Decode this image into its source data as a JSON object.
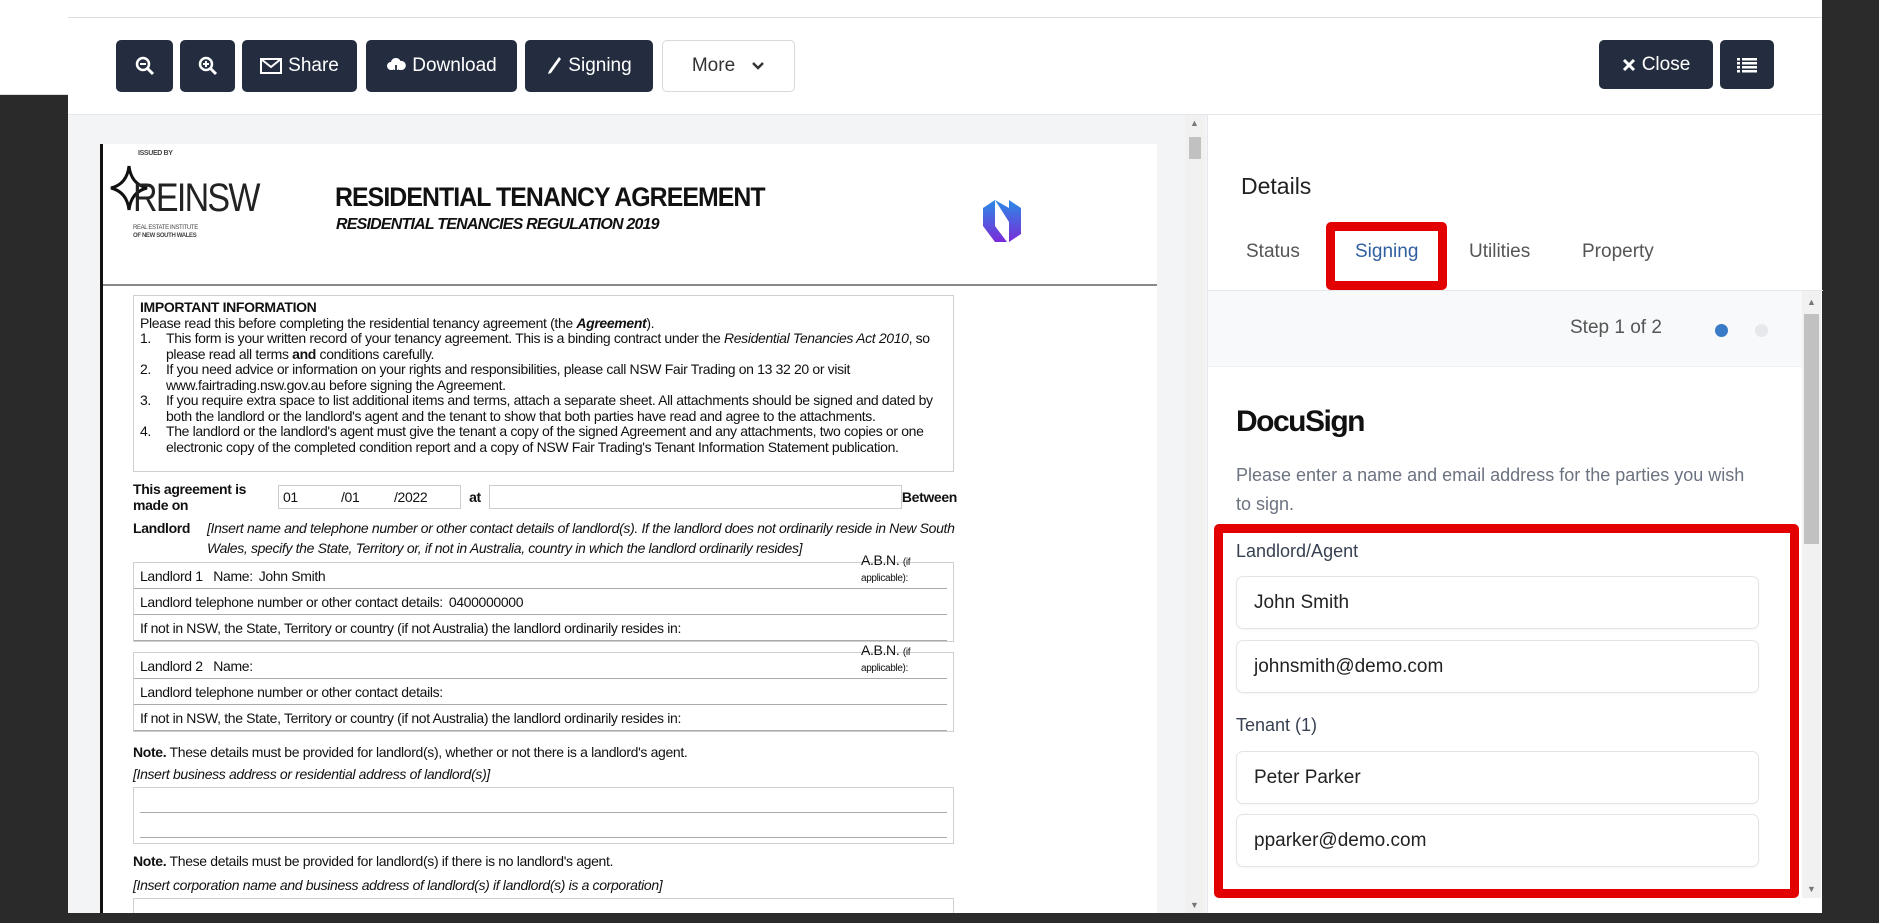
{
  "toolbar": {
    "zoom_out": "zoom-out",
    "zoom_in": "zoom-in",
    "share": "Share",
    "download": "Download",
    "signing": "Signing",
    "more": "More",
    "close": "Close"
  },
  "document": {
    "issued_by": "ISSUED BY",
    "logo_text": "REINSW",
    "logo_sub1": "REAL ESTATE INSTITUTE",
    "logo_sub2": "OF NEW SOUTH WALES",
    "title": "RESIDENTIAL TENANCY AGREEMENT",
    "subtitle": "RESIDENTIAL TENANCIES REGULATION 2019",
    "important": {
      "heading": "IMPORTANT INFORMATION",
      "intro_a": "Please read this before completing the residential tenancy agreement (the ",
      "intro_b": "Agreement",
      "intro_c": ").",
      "items": [
        {
          "n": "1.",
          "a": "This form is your written record of your tenancy agreement. This is a binding contract under the ",
          "i": "Residential Tenancies Act 2010",
          "b": ", so please read all terms ",
          "bold": "and",
          "c": " conditions carefully."
        },
        {
          "n": "2.",
          "a": "If you need advice or information on your rights and responsibilities, please call NSW Fair Trading on 13 32 20 or visit www.fairtrading.nsw.gov.au before signing the Agreement."
        },
        {
          "n": "3.",
          "a": "If you require extra space to list additional items and terms, attach a separate sheet. All attachments should be signed and dated by both the landlord or the landlord's agent and the tenant to show that both parties have read and agree to the attachments."
        },
        {
          "n": "4.",
          "a": "The landlord or the landlord's agent must give the tenant a copy of the signed Agreement and any attachments, two copies or one electronic copy of the completed condition report and a copy of NSW Fair Trading's Tenant Information Statement publication."
        }
      ]
    },
    "made_on_label": "This agreement is made on",
    "date_day": "01",
    "date_month": "/01",
    "date_year": "/2022",
    "at_label": "at",
    "between_label": "Between",
    "landlord_label": "Landlord",
    "landlord_instruction": "[Insert name and telephone number or other contact details of landlord(s). If the landlord does not ordinarily reside in New South Wales, specify the State, Territory or, if not in Australia, country in which the landlord ordinarily resides]",
    "landlords": [
      {
        "name_label": "Landlord 1   Name:",
        "name": "John Smith",
        "abn": "A.B.N.",
        "abn_note": "(if applicable):",
        "phone_label": "Landlord telephone number or other contact details:",
        "phone": "0400000000",
        "resides_label": "If not in NSW, the State, Territory or country (if not Australia) the landlord ordinarily resides in:"
      },
      {
        "name_label": "Landlord 2   Name:",
        "name": "",
        "abn": "A.B.N.",
        "abn_note": "(if applicable):",
        "phone_label": "Landlord telephone number or other contact details:",
        "phone": "",
        "resides_label": "If not in NSW, the State, Territory or country (if not Australia) the landlord ordinarily resides in:"
      }
    ],
    "note1_bold": "Note.",
    "note1": " These details must be provided for landlord(s), whether or not there is a landlord's agent.",
    "note1_instruction": "[Insert business address or residential address of landlord(s)]",
    "note2_bold": "Note.",
    "note2": " These details must be provided for landlord(s) if there is no landlord's agent.",
    "note2_instruction": "[Insert corporation name and business address of landlord(s) if landlord(s) is a corporation]"
  },
  "panel": {
    "title": "Details",
    "tabs": [
      {
        "label": "Status",
        "active": false
      },
      {
        "label": "Signing",
        "active": true
      },
      {
        "label": "Utilities",
        "active": false
      },
      {
        "label": "Property",
        "active": false
      }
    ],
    "step_text": "Step 1 of 2",
    "current_step": 1,
    "total_steps": 2,
    "docusign_logo": "DocuSign",
    "instructions": "Please enter a name and email address for the parties you wish to sign.",
    "landlord_label": "Landlord/Agent",
    "landlord_name": "John Smith",
    "landlord_email": "johnsmith@demo.com",
    "tenant_label": "Tenant (1)",
    "tenant_name": "Peter Parker",
    "tenant_email": "pparker@demo.com"
  },
  "colors": {
    "button_dark": "#232d3f",
    "highlight_red": "#e30000",
    "active_tab": "#2f5f9e",
    "step_active": "#3a7bc8"
  }
}
